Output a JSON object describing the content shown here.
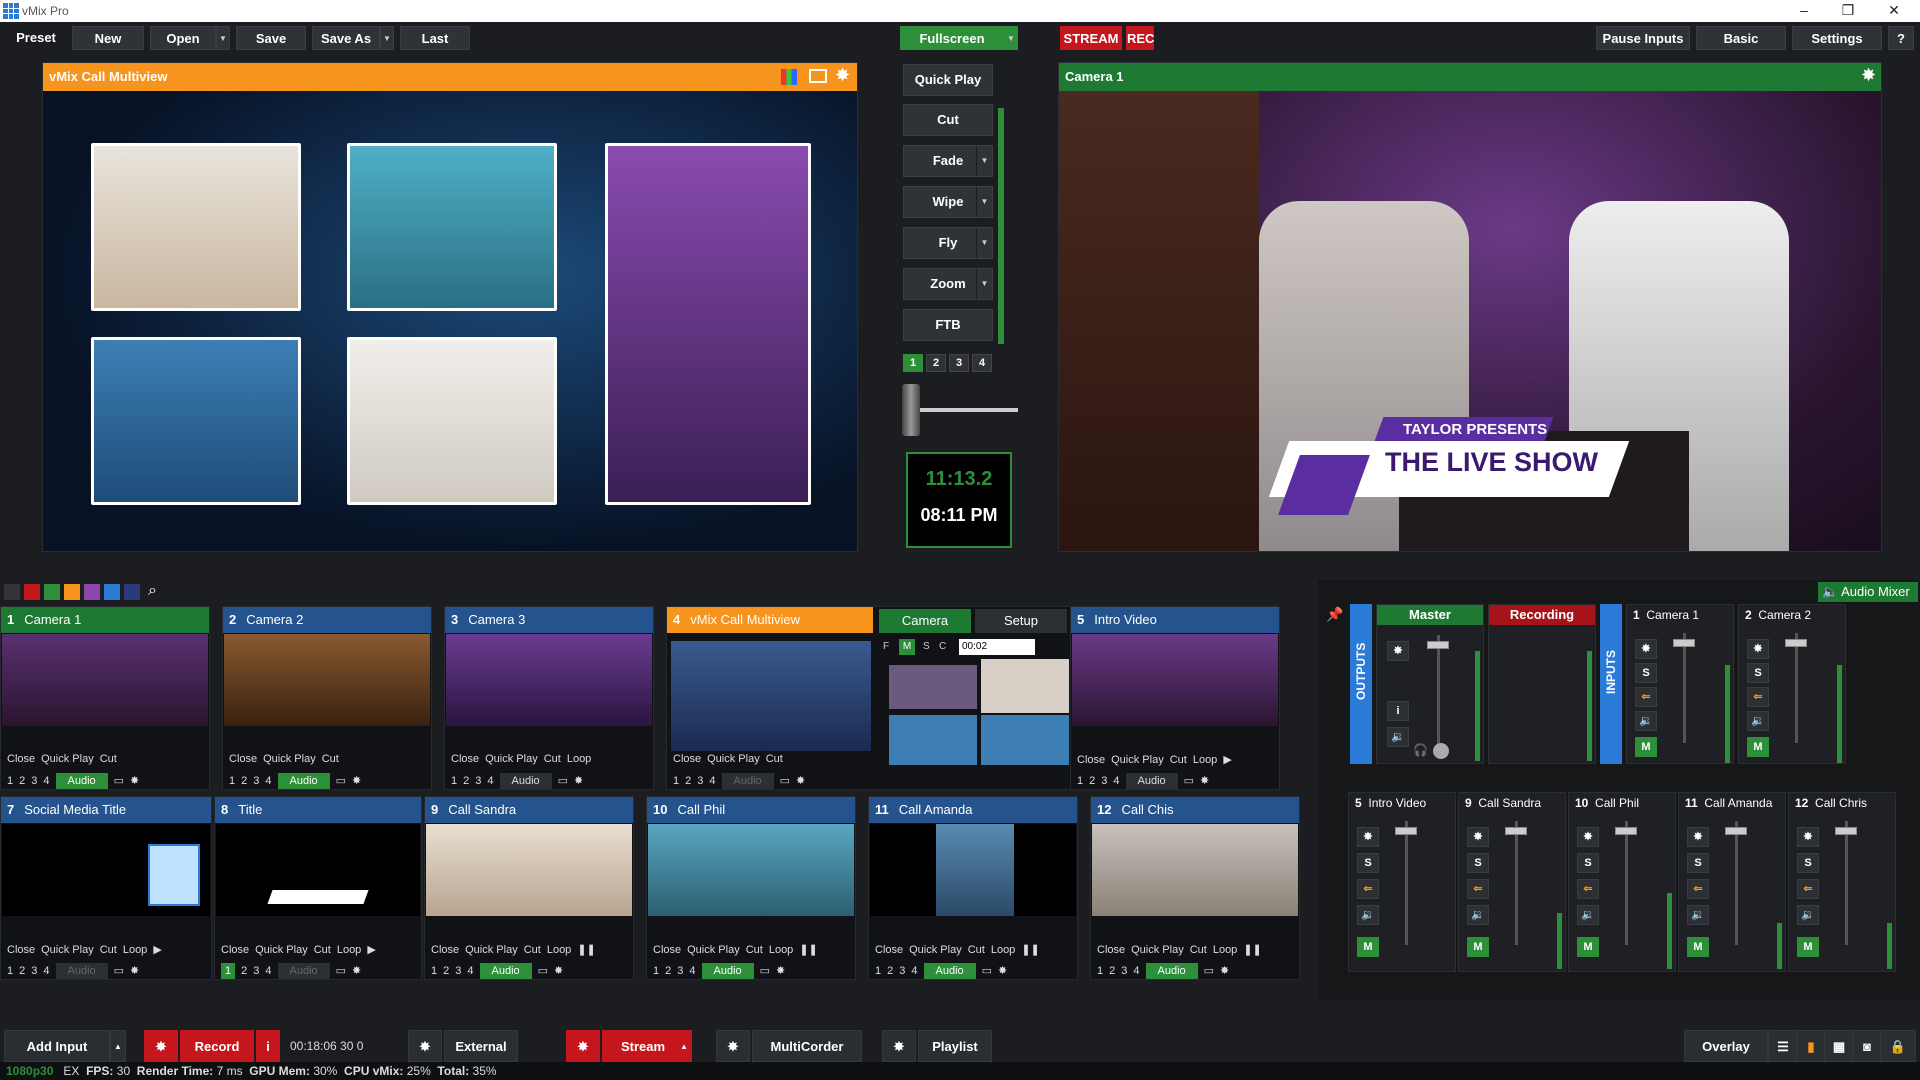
{
  "titlebar": {
    "title": "vMix Pro",
    "min": "–",
    "max": "❐",
    "close": "✕"
  },
  "menu": {
    "preset": "Preset",
    "new": "New",
    "open": "Open",
    "save": "Save",
    "save_as": "Save As",
    "last": "Last",
    "fullscreen": "Fullscreen",
    "stream": "STREAM",
    "rec": "REC",
    "pause_inputs": "Pause Inputs",
    "basic": "Basic",
    "settings": "Settings",
    "help": "?"
  },
  "preview": {
    "title": "vMix Call Multiview"
  },
  "program": {
    "title": "Camera 1",
    "lower_third_top": "TAYLOR PRESENTS",
    "lower_third_main": "THE LIVE SHOW"
  },
  "transitions": {
    "quick_play": "Quick Play",
    "cut": "Cut",
    "fade": "Fade",
    "wipe": "Wipe",
    "fly": "Fly",
    "zoom": "Zoom",
    "ftb": "FTB",
    "nums": [
      "1",
      "2",
      "3",
      "4"
    ]
  },
  "clock": {
    "duration": "11:13.2",
    "time": "08:11 PM"
  },
  "colors": {
    "accent_orange": "#f7941d",
    "program_green": "#2d8f3a",
    "input_blue": "#24538d",
    "record_red": "#c4161c"
  },
  "tile_ctrl": {
    "close": "Close",
    "quick_play": "Quick Play",
    "cut": "Cut",
    "loop": "Loop",
    "audio": "Audio",
    "n1": "1",
    "n2": "2",
    "n3": "3",
    "n4": "4"
  },
  "inputs": [
    {
      "num": "1",
      "name": "Camera 1"
    },
    {
      "num": "2",
      "name": "Camera 2"
    },
    {
      "num": "3",
      "name": "Camera 3"
    },
    {
      "num": "4",
      "name": "vMix Call Multiview"
    },
    {
      "num": "5",
      "name": "Intro Video"
    },
    {
      "num": "7",
      "name": "Social Media Title"
    },
    {
      "num": "8",
      "name": "Title"
    },
    {
      "num": "9",
      "name": "Call Sandra"
    },
    {
      "num": "10",
      "name": "Call Phil"
    },
    {
      "num": "11",
      "name": "Call Amanda"
    },
    {
      "num": "12",
      "name": "Call Chis"
    }
  ],
  "call_panel": {
    "camera": "Camera",
    "setup": "Setup",
    "f": "F",
    "m": "M",
    "s": "S",
    "c": "C",
    "delay": "00:02"
  },
  "mixer": {
    "title": "Audio Mixer",
    "outputs": "OUTPUTS",
    "inputs": "INPUTS",
    "master": "Master",
    "recording": "Recording",
    "m": "M",
    "s": "S",
    "i": "i",
    "channels": [
      {
        "num": "1",
        "name": "Camera 1"
      },
      {
        "num": "2",
        "name": "Camera 2"
      },
      {
        "num": "5",
        "name": "Intro Video"
      },
      {
        "num": "9",
        "name": "Call Sandra"
      },
      {
        "num": "10",
        "name": "Call Phil"
      },
      {
        "num": "11",
        "name": "Call Amanda"
      },
      {
        "num": "12",
        "name": "Call Chris"
      }
    ]
  },
  "bottom": {
    "add_input": "Add Input",
    "record": "Record",
    "rec_info": "i",
    "rec_time": "00:18:06 30 0",
    "external": "External",
    "stream": "Stream",
    "multicorder": "MultiCorder",
    "playlist": "Playlist",
    "overlay": "Overlay"
  },
  "status": {
    "res": "1080p30",
    "ex": "EX",
    "fps_l": "FPS:",
    "fps": "30",
    "rt_l": "Render Time:",
    "rt": "7 ms",
    "gpu_l": "GPU Mem:",
    "gpu": "30%",
    "cpu_l": "CPU vMix:",
    "cpu": "25%",
    "tot_l": "Total:",
    "tot": "35%"
  }
}
